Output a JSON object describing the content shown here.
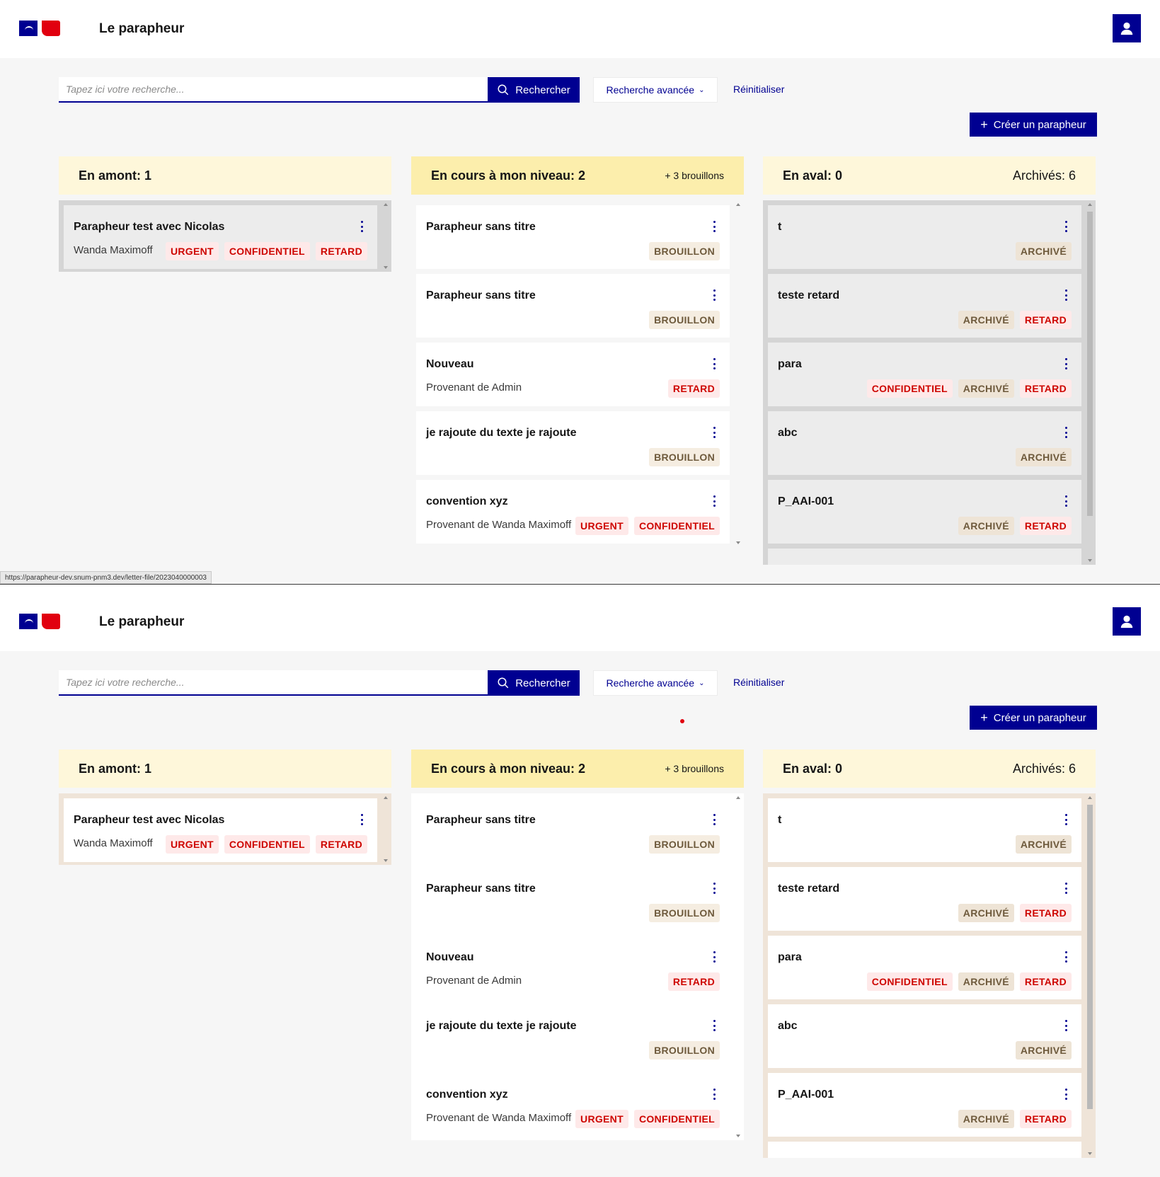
{
  "screens": [
    {
      "header": {
        "title": "Le parapheur"
      },
      "search": {
        "placeholder": "Tapez ici votre recherche...",
        "button_label": "Rechercher",
        "advanced_label": "Recherche avancée",
        "reset_label": "Réinitialiser"
      },
      "create_label": "Créer un parapheur",
      "columns": {
        "upstream": {
          "title": "En amont: 1"
        },
        "current": {
          "title": "En cours à mon niveau: 2",
          "extra": "+ 3 brouillons"
        },
        "downstream": {
          "title": "En aval: 0",
          "extra": "Archivés: 6"
        }
      },
      "statusbar": "https://parapheur-dev.snum-pnm3.dev/letter-file/2023040000003"
    },
    {
      "header": {
        "title": "Le parapheur"
      },
      "search": {
        "placeholder": "Tapez ici votre recherche...",
        "button_label": "Rechercher",
        "advanced_label": "Recherche avancée",
        "reset_label": "Réinitialiser"
      },
      "create_label": "Créer un parapheur",
      "columns": {
        "upstream": {
          "title": "En amont: 1"
        },
        "current": {
          "title": "En cours à mon niveau: 2",
          "extra": "+ 3 brouillons"
        },
        "downstream": {
          "title": "En aval: 0",
          "extra": "Archivés: 6"
        }
      }
    }
  ],
  "cards": {
    "upstream": [
      {
        "title": "Parapheur test avec Nicolas",
        "subtitle": "Wanda Maximoff",
        "tags": [
          "URGENT",
          "CONFIDENTIEL",
          "RETARD"
        ]
      }
    ],
    "current": [
      {
        "title": "Parapheur sans titre",
        "subtitle": "",
        "tags": [
          "BROUILLON"
        ]
      },
      {
        "title": "Parapheur sans titre",
        "subtitle": "",
        "tags": [
          "BROUILLON"
        ]
      },
      {
        "title": "Nouveau",
        "subtitle": "Provenant de Admin",
        "tags": [
          "RETARD"
        ]
      },
      {
        "title": "je rajoute du texte je rajoute",
        "subtitle": "",
        "tags": [
          "BROUILLON"
        ]
      },
      {
        "title": "convention xyz",
        "subtitle": "Provenant de Wanda Maximoff",
        "tags": [
          "URGENT",
          "CONFIDENTIEL"
        ]
      }
    ],
    "downstream": [
      {
        "title": "t",
        "subtitle": "",
        "tags": [
          "ARCHIVÉ"
        ]
      },
      {
        "title": "teste retard",
        "subtitle": "",
        "tags": [
          "ARCHIVÉ",
          "RETARD"
        ]
      },
      {
        "title": "para",
        "subtitle": "",
        "tags": [
          "CONFIDENTIEL",
          "ARCHIVÉ",
          "RETARD"
        ]
      },
      {
        "title": "abc",
        "subtitle": "",
        "tags": [
          "ARCHIVÉ"
        ]
      },
      {
        "title": "P_AAI-001",
        "subtitle": "",
        "tags": [
          "ARCHIVÉ",
          "RETARD"
        ]
      },
      {
        "title": "",
        "subtitle": "",
        "tags": []
      }
    ]
  },
  "colors": {
    "primary": "#000091",
    "marianne_red": "#e1000f",
    "tag_red_text": "#ce0500",
    "tag_red_bg": "#fee9e9",
    "tag_beige_bg": "#f5ede1",
    "col_head_light": "#fef7da",
    "col_head_strong": "#fceeac"
  },
  "icons": {
    "user": "user-icon",
    "search": "search-icon",
    "chevron": "chevron-down-icon",
    "plus": "plus-icon",
    "menu": "more-vertical-icon"
  }
}
